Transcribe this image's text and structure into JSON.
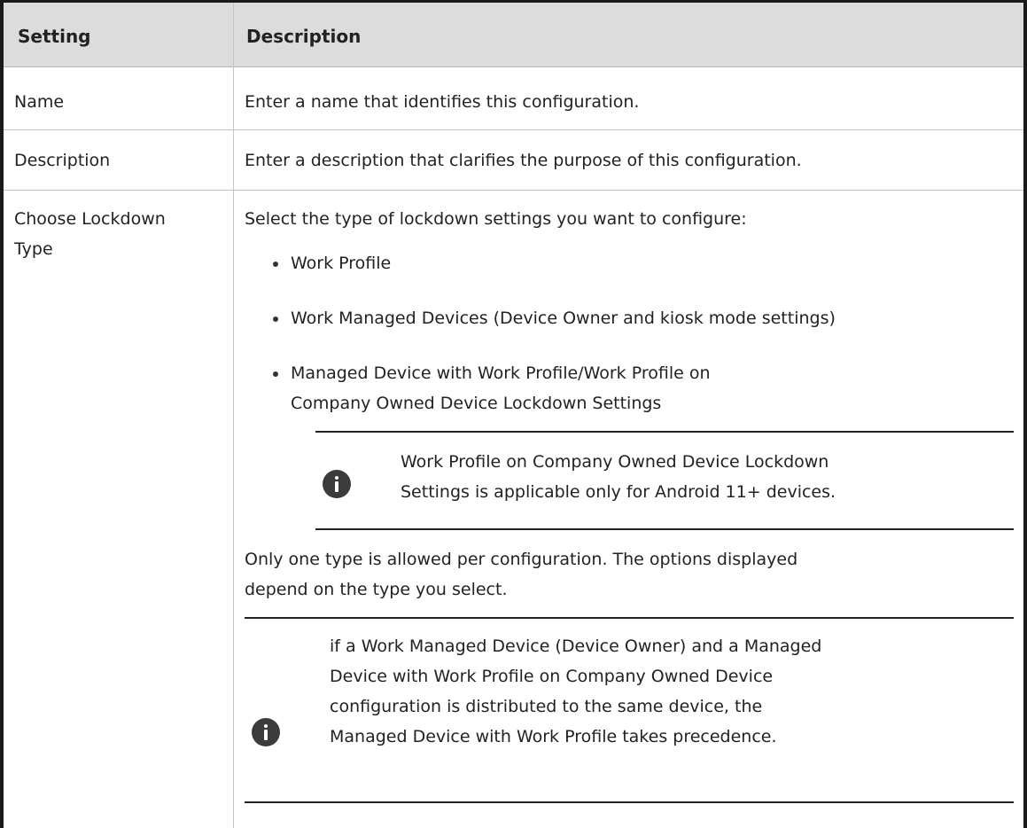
{
  "table": {
    "headers": {
      "setting": "Setting",
      "description": "Description"
    },
    "rows": [
      {
        "setting": "Name",
        "description": "Enter a name that identifies this configuration."
      },
      {
        "setting": "Description",
        "description": "Enter a description that clarifies the purpose of this configuration."
      },
      {
        "setting": "Choose Lockdown Type",
        "intro": "Select the type of lockdown settings you want to configure:",
        "options": [
          "Work Profile",
          "Work Managed Devices (Device Owner and kiosk mode settings)",
          "Managed Device with Work Profile/Work Profile on Company Owned Device Lockdown Settings"
        ],
        "note1": "Work Profile on Company Owned Device Lockdown Settings is applicable only for Android 11+ devices.",
        "paragraph": "Only one type is allowed per configuration. The options displayed depend on the type you select.",
        "note2": "if a Work Managed Device (Device Owner) and a Managed Device with Work Profile on Company Owned Device configuration is distributed to the same device, the Managed Device with Work Profile takes precedence."
      }
    ]
  },
  "icons": {
    "note": "info-icon"
  },
  "colors": {
    "header_bg": "#dcdcdc",
    "border": "#1a1a1a",
    "icon": "#3b3b3b"
  }
}
